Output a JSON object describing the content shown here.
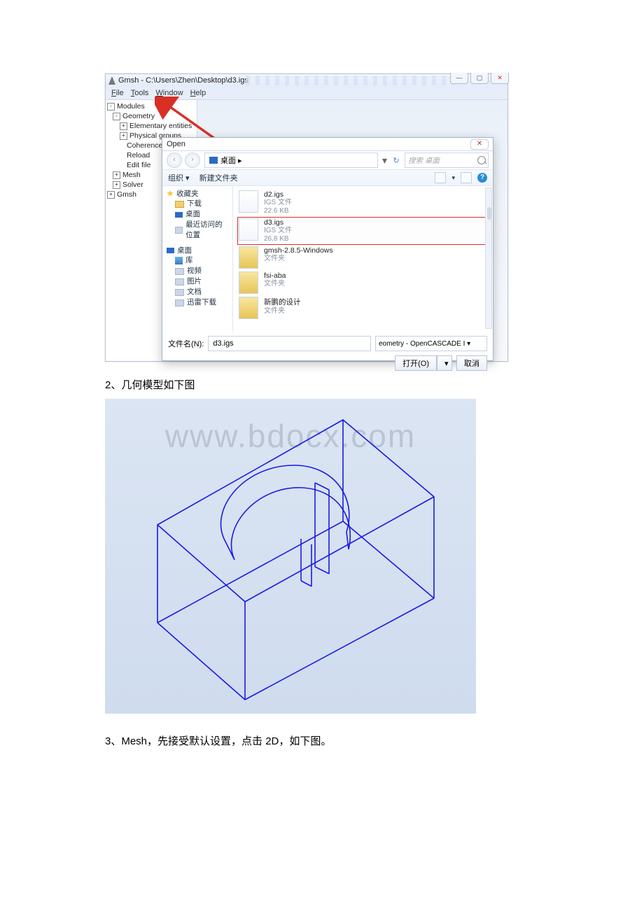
{
  "gmsh": {
    "title": "Gmsh - C:\\Users\\Zhen\\Desktop\\d3.igs",
    "win_min": "—",
    "win_max": "▢",
    "win_close": "✕",
    "menu": {
      "file": "File",
      "tools": "Tools",
      "window": "Window",
      "help": "Help"
    },
    "tree": {
      "modules": "Modules",
      "geometry": "Geometry",
      "elem": "Elementary entities",
      "phys": "Physical groups",
      "coherence": "Coherence",
      "reload": "Reload",
      "editfile": "Edit file",
      "mesh": "Mesh",
      "solver": "Solver",
      "gmsh": "Gmsh"
    }
  },
  "dialog": {
    "title": "Open",
    "close": "✕",
    "crumb": "桌面 ▸",
    "refresh_icon": "↻",
    "search_placeholder": "搜索 桌面",
    "toolbar": {
      "organize": "组织 ▾",
      "newfolder": "新建文件夹",
      "views": "⋮≣ ▾"
    },
    "side": {
      "fav": "收藏夹",
      "downloads": "下载",
      "desktop": "桌面",
      "recent": "最近访问的位置",
      "desktop2": "桌面",
      "libs": "库",
      "video": "视频",
      "pictures": "图片",
      "docs": "文档",
      "xunlei": "迅雷下载"
    },
    "files": {
      "f1": {
        "name": "d2.igs",
        "type": "IGS 文件",
        "size": "22.6 KB"
      },
      "f2": {
        "name": "d3.igs",
        "type": "IGS 文件",
        "size": "26.8 KB"
      },
      "f3": {
        "name": "gmsh-2.8.5-Windows",
        "type": "文件夹"
      },
      "f4": {
        "name": "fsi-aba",
        "type": "文件夹"
      },
      "f5": {
        "name": "新鹏的设计",
        "type": "文件夹"
      }
    },
    "filename_label": "文件名(N):",
    "filename_value": "d3.igs",
    "filter": "eometry - OpenCASCADE I ▾",
    "open_btn": "打开(O)",
    "cancel_btn": "取消"
  },
  "text": {
    "line2": "2、几何模型如下图",
    "line3": "3、Mesh，先接受默认设置，点击 2D，如下图。"
  },
  "watermark": "www.bdocx.com"
}
